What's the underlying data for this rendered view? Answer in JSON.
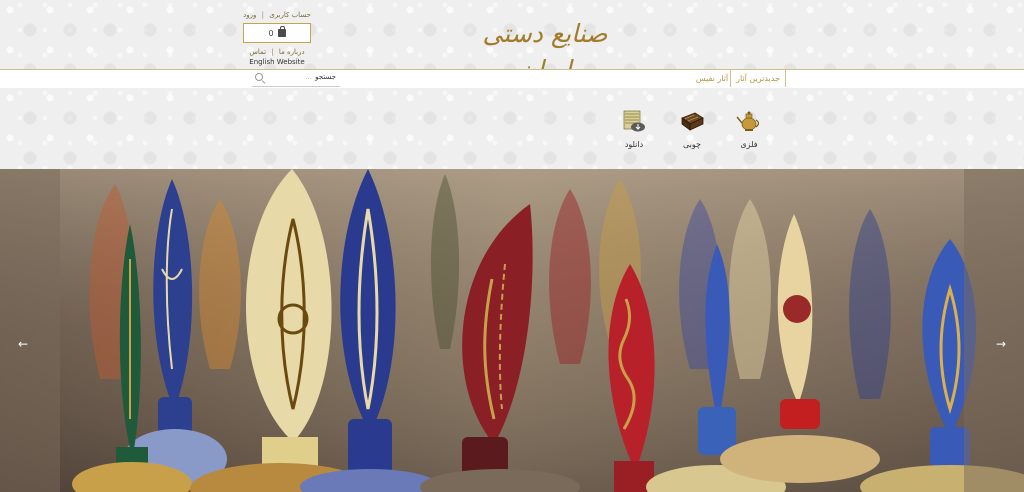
{
  "header": {
    "logo_text": "صنایع دستی ایران",
    "account_link": "حساب کاربری",
    "login_link": "ورود",
    "cart_count": "0",
    "about_link": "درباره ما",
    "contact_link": "تماس",
    "english_link": "English Website",
    "separator": "|"
  },
  "navbar": {
    "items": [
      {
        "label": "جدیدترین آثار"
      },
      {
        "label": "آثار نفیس"
      }
    ],
    "search": {
      "label": "جستجو",
      "placeholder": "..."
    }
  },
  "categories": [
    {
      "label": "فلزی",
      "icon": "teapot-icon"
    },
    {
      "label": "چوبی",
      "icon": "wooden-box-icon"
    },
    {
      "label": "دانلود",
      "icon": "download-cloud-icon"
    }
  ],
  "hero": {
    "prev_arrow": "←",
    "next_arrow": "→",
    "colors": {
      "gold": "#c8a04a",
      "blue": "#2d3f8f",
      "red": "#9a1f25",
      "green": "#1f5a3a",
      "cream": "#e8d9a8"
    }
  }
}
